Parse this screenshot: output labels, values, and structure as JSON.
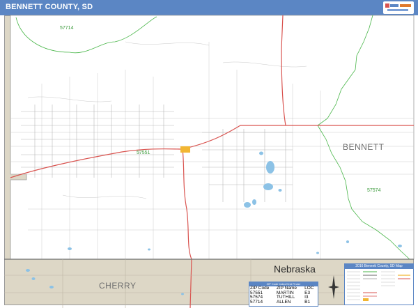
{
  "header": {
    "title": "BENNETT COUNTY, SD"
  },
  "map": {
    "county_label": "BENNETT",
    "state_label": "Nebraska",
    "neighbor_county_label": "CHERRY",
    "zip_labels": {
      "z57714": "57714",
      "z57551": "57551",
      "z57574": "57574"
    },
    "colors": {
      "title_bar": "#5b86c4",
      "county_fill": "#ffffff",
      "outside_fill": "#ddd7c6",
      "highway": "#d9534f",
      "zip_boundary": "#49b649",
      "water": "#8cc2e6",
      "town": "#f2b632"
    }
  },
  "zip_table": {
    "title": "ZIP Code Index/Grid Finder",
    "headers": [
      "ZIP Code",
      "ZIP Name",
      "LOC"
    ],
    "rows": [
      [
        "57551",
        "MARTIN",
        "E3"
      ],
      [
        "57574",
        "TUTHILL",
        "I3"
      ],
      [
        "57714",
        "ALLEN",
        "B1"
      ]
    ]
  },
  "legend": {
    "title": "2016 Bennett County, SD Map"
  },
  "icons": {
    "compass": "compass-rose-icon",
    "logo": "publisher-logo-icon"
  }
}
